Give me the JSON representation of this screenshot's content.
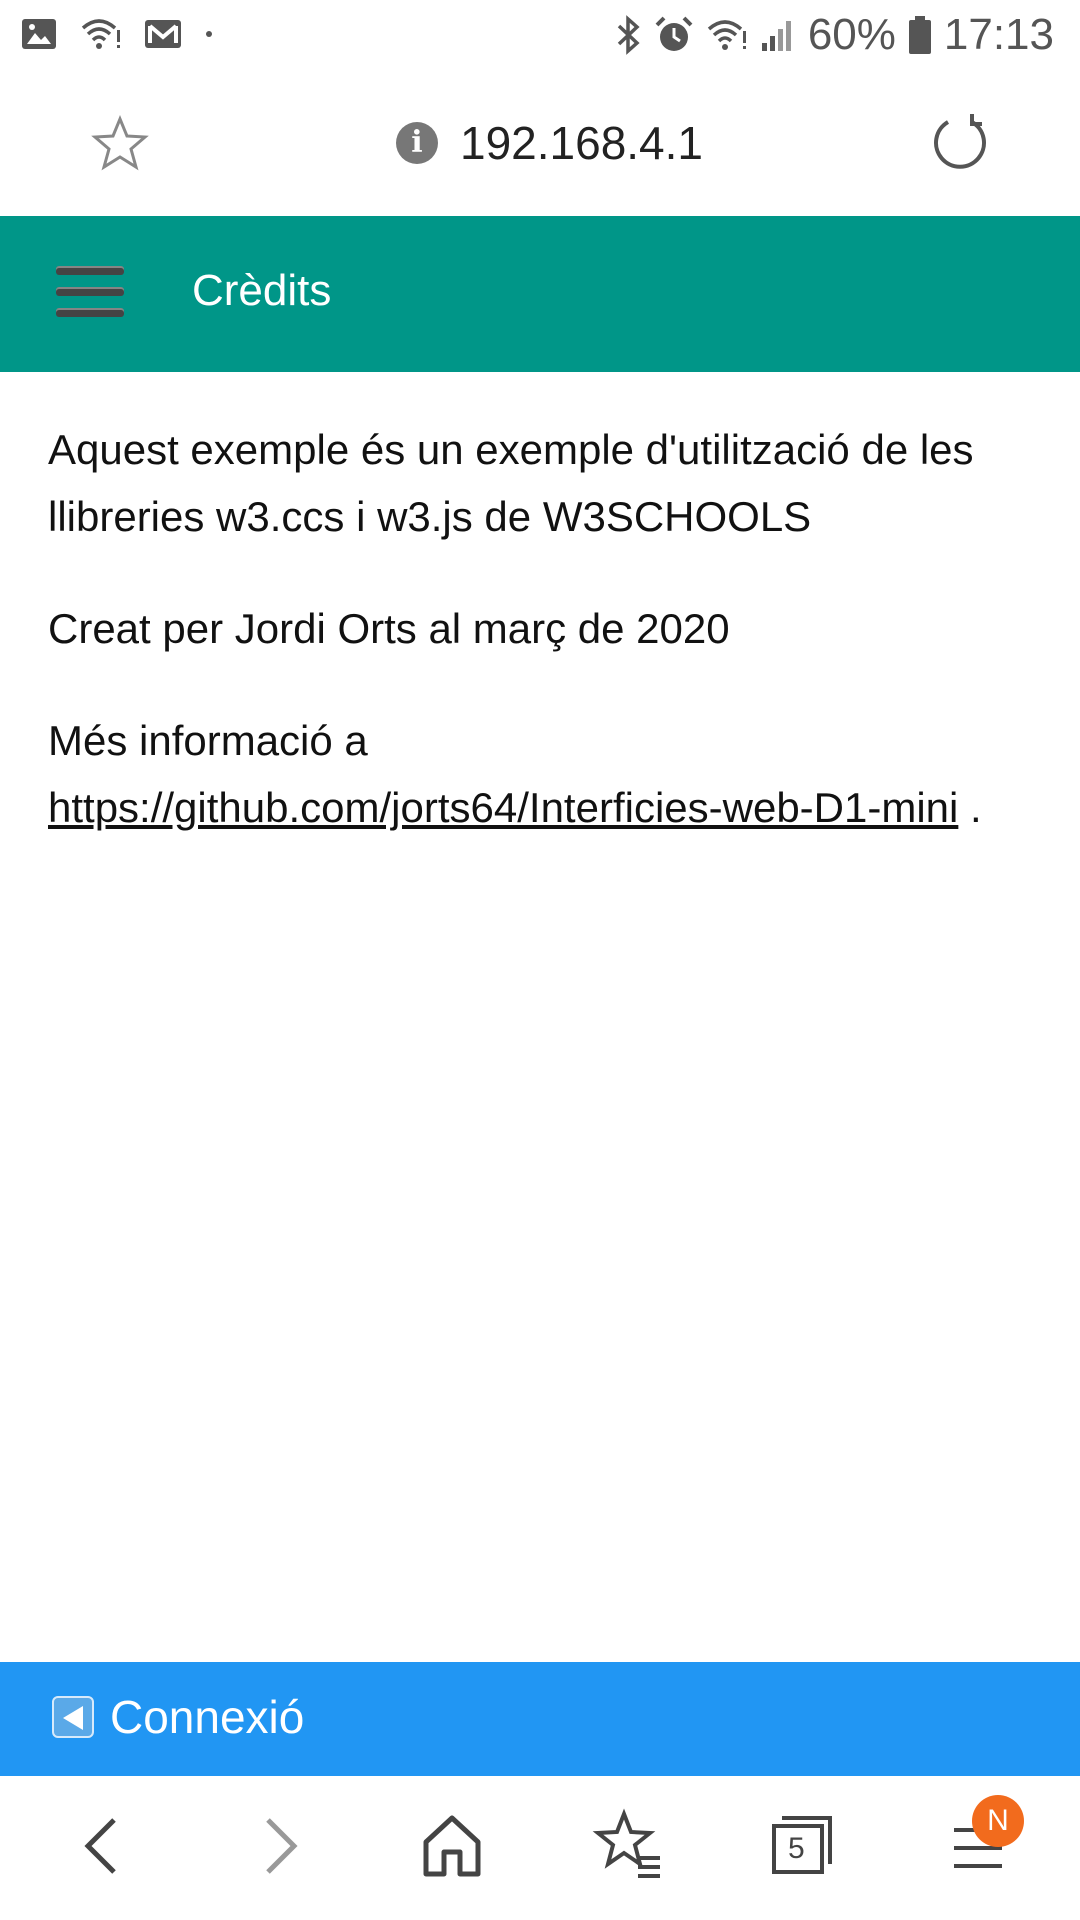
{
  "status_bar": {
    "battery": "60%",
    "time": "17:13",
    "left_icons": [
      "image-icon",
      "wifi-icon",
      "mail-icon",
      "dot-icon"
    ],
    "right_icons": [
      "bluetooth-icon",
      "alarm-icon",
      "wifi-icon",
      "signal-icon",
      "battery-icon"
    ]
  },
  "browser": {
    "url": "192.168.4.1"
  },
  "header": {
    "title": "Crèdits"
  },
  "content": {
    "paragraph1": "Aquest exemple és un exemple d'utilització de les llibreries w3.ccs i w3.js de W3SCHOOLS",
    "paragraph2": "Creat per Jordi Orts al març de 2020",
    "more_info_prefix": "Més informació a",
    "link_text": "https://github.com/jorts64/Interficies-web-D1-mini",
    "more_info_suffix": " ."
  },
  "footer": {
    "button_label": "Connexió"
  },
  "bottom_nav": {
    "tabs_count": "5",
    "menu_badge": "N"
  }
}
